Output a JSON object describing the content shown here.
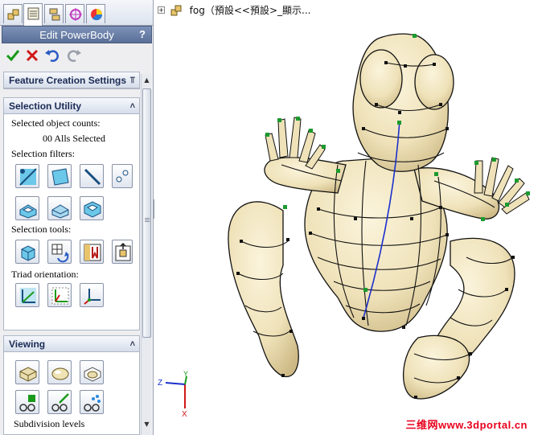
{
  "panel": {
    "title": "Edit PowerBody",
    "help_label": "?",
    "tabs": [
      "feature-manager-icon",
      "property-manager-icon",
      "configuration-manager-icon",
      "dimxpert-icon",
      "display-manager-icon"
    ],
    "actions": [
      "ok-check-icon",
      "cancel-x-icon",
      "undo-icon",
      "redo-icon"
    ],
    "groups": {
      "feature_creation": {
        "header": "Feature Creation Settings"
      },
      "selection": {
        "header": "Selection Utility",
        "selected_counts_label": "Selected object counts:",
        "selected_counts_value": "00 Alls Selected",
        "filters_label": "Selection filters:",
        "tools_label": "Selection tools:",
        "triad_label": "Triad orientation:"
      },
      "viewing": {
        "header": "Viewing",
        "subdivision_label": "Subdivision levels"
      }
    }
  },
  "viewport": {
    "tree_label": "fog（預設<<預設>_顯示..."
  },
  "triad": {
    "z": "Z",
    "y": "Y",
    "x": "X"
  },
  "watermark": "三维网www.3dportal.cn",
  "colors": {
    "title_bar": "#5a6f98",
    "model_surface": "#f0e4bf",
    "mesh_line": "#111111",
    "control_point_green": "#1c9a2e",
    "center_line": "#1a2fcc",
    "watermark": "#e8001c"
  }
}
